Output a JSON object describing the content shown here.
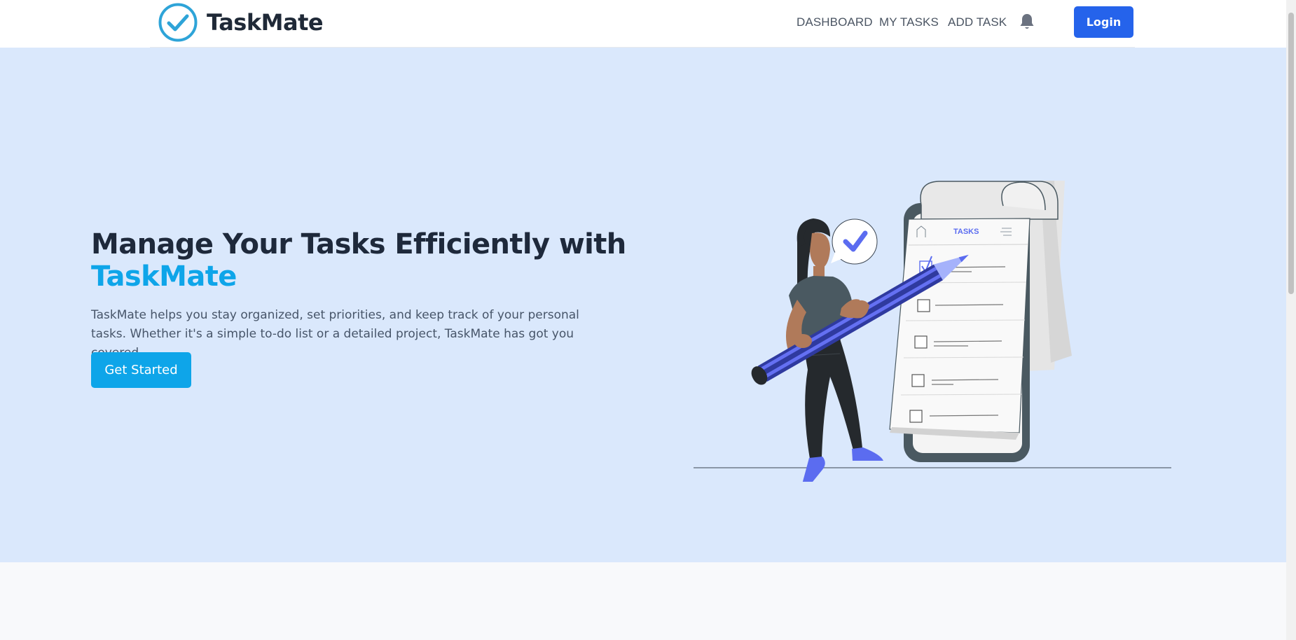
{
  "brand": {
    "name": "TaskMate",
    "logo_icon": "check-circle-icon",
    "accent_color": "#0ea5e9",
    "primary_color": "#2563eb"
  },
  "nav": {
    "dashboard": "DASHBOARD",
    "my_tasks": "MY TASKS",
    "add_task": "ADD TASK",
    "notifications_icon": "bell-icon",
    "login": "Login"
  },
  "hero": {
    "title_line1": "Manage Your Tasks Efficiently with",
    "title_accent": "TaskMate",
    "description": "TaskMate helps you stay organized, set priorities, and keep track of your personal tasks. Whether it's a simple to-do list or a detailed project, TaskMate has got you covered.",
    "cta": "Get Started",
    "background_color": "#dae8fc"
  },
  "illustration": {
    "phone_header": "TASKS"
  }
}
